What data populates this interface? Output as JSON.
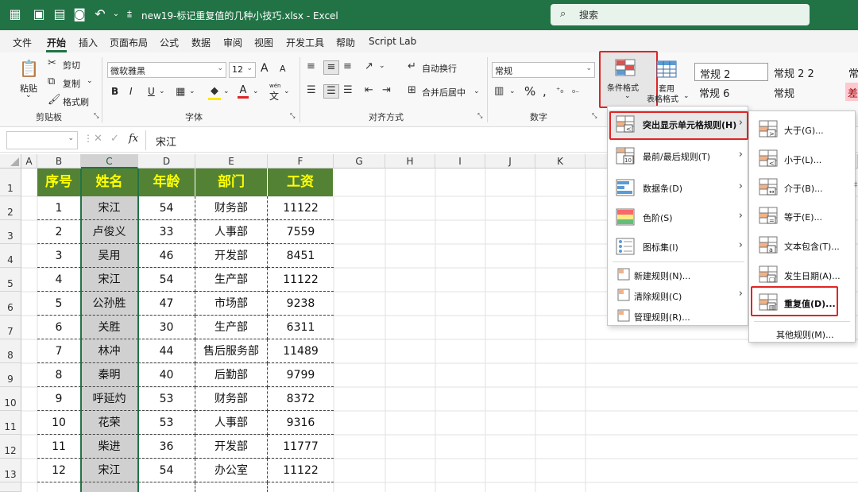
{
  "titlebar": {
    "filename": "new19-标记重复值的几种小技巧.xlsx  -  Excel",
    "search": "搜索",
    "undo_dropdown": "⌄",
    "qat_more": "⩲"
  },
  "menubar": {
    "tabs": [
      "文件",
      "开始",
      "插入",
      "页面布局",
      "公式",
      "数据",
      "审阅",
      "视图",
      "开发工具",
      "帮助",
      "Script Lab"
    ]
  },
  "ribbon": {
    "clipboard": {
      "paste": "粘贴",
      "cut": "剪切",
      "copy": "复制",
      "format_painter": "格式刷",
      "group": "剪贴板"
    },
    "font": {
      "name": "微软雅黑",
      "size": "12",
      "bold": "B",
      "italic": "I",
      "underline": "U",
      "grow": "A",
      "shrink": "A",
      "group": "字体",
      "wen": "wén"
    },
    "alignment": {
      "wrap": "自动换行",
      "merge": "合并后居中",
      "group": "对齐方式"
    },
    "number": {
      "format": "常规",
      "group": "数字",
      "percent": "%"
    },
    "conditional_format": "条件格式",
    "table_format": {
      "line1": "套用",
      "line2": "表格格式"
    },
    "styles": [
      "常规 2",
      "常规 2 2",
      "常",
      "常规 6",
      "常规",
      "差"
    ]
  },
  "formula_bar": {
    "fx": "fx",
    "value": "宋江"
  },
  "columns": [
    "A",
    "B",
    "C",
    "D",
    "E",
    "F",
    "G",
    "H",
    "I",
    "J",
    "K"
  ],
  "rows": [
    "1",
    "2",
    "3",
    "4",
    "5",
    "6",
    "7",
    "8",
    "9",
    "10",
    "11",
    "12",
    "13"
  ],
  "table": {
    "headers": [
      "序号",
      "姓名",
      "年龄",
      "部门",
      "工资"
    ],
    "rows": [
      [
        "1",
        "宋江",
        "54",
        "财务部",
        "11122"
      ],
      [
        "2",
        "卢俊义",
        "33",
        "人事部",
        "7559"
      ],
      [
        "3",
        "吴用",
        "46",
        "开发部",
        "8451"
      ],
      [
        "4",
        "宋江",
        "54",
        "生产部",
        "11122"
      ],
      [
        "5",
        "公孙胜",
        "47",
        "市场部",
        "9238"
      ],
      [
        "6",
        "关胜",
        "30",
        "生产部",
        "6311"
      ],
      [
        "7",
        "林冲",
        "44",
        "售后服务部",
        "11489"
      ],
      [
        "8",
        "秦明",
        "40",
        "后勤部",
        "9799"
      ],
      [
        "9",
        "呼延灼",
        "53",
        "财务部",
        "8372"
      ],
      [
        "10",
        "花荣",
        "53",
        "人事部",
        "9316"
      ],
      [
        "11",
        "柴进",
        "36",
        "开发部",
        "11777"
      ],
      [
        "12",
        "宋江",
        "54",
        "办公室",
        "11122"
      ]
    ]
  },
  "cf_menu": {
    "items": [
      {
        "label": "突出显示单元格规则(H)",
        "icon": "highlight-cells-icon"
      },
      {
        "label": "最前/最后规则(T)",
        "icon": "top-bottom-icon"
      },
      {
        "label": "数据条(D)",
        "icon": "data-bars-icon"
      },
      {
        "label": "色阶(S)",
        "icon": "color-scales-icon"
      },
      {
        "label": "图标集(I)",
        "icon": "icon-sets-icon"
      }
    ],
    "small_items": [
      {
        "label": "新建规则(N)...",
        "icon": "new-rule-icon"
      },
      {
        "label": "清除规则(C)",
        "icon": "clear-rules-icon"
      },
      {
        "label": "管理规则(R)...",
        "icon": "manage-rules-icon"
      }
    ]
  },
  "sub_menu": {
    "items": [
      "大于(G)...",
      "小于(L)...",
      "介于(B)...",
      "等于(E)...",
      "文本包含(T)...",
      "发生日期(A)...",
      "重复值(D)..."
    ],
    "more": "其他规则(M)..."
  },
  "colors": {
    "excel_green": "#217346",
    "header_green": "#548235",
    "header_text": "#ffff00",
    "highlight_red": "#e02424"
  }
}
